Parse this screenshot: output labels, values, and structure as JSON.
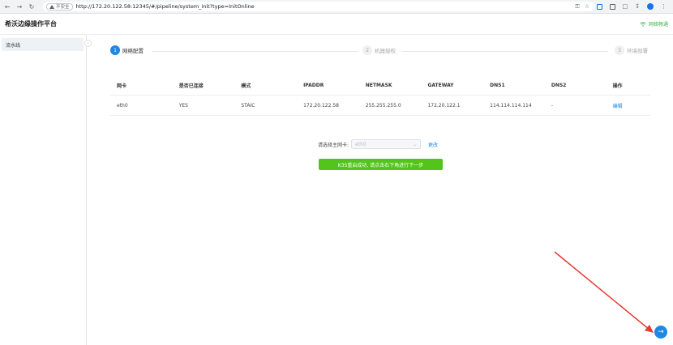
{
  "browser": {
    "insecure_label": "不安全",
    "url": "http://172.20.122.58:12345/#/pipeline/system_init?type=InitOnline"
  },
  "app": {
    "title": "希沃边缘操作平台",
    "network_status": "网络畅通"
  },
  "sidebar": {
    "items": [
      {
        "label": "流水线"
      }
    ]
  },
  "steps": [
    {
      "number": "1",
      "label": "网络配置",
      "state": "active"
    },
    {
      "number": "2",
      "label": "机器授权",
      "state": "inactive"
    },
    {
      "number": "3",
      "label": "环境部署",
      "state": "inactive"
    }
  ],
  "table": {
    "headers": [
      "网卡",
      "是否已连接",
      "模式",
      "IPADDR",
      "NETMASK",
      "GATEWAY",
      "DNS1",
      "DNS2",
      "操作"
    ],
    "rows": [
      [
        "eth0",
        "YES",
        "STAIC",
        "172.20.122.58",
        "255.255.255.0",
        "172.20.122.1",
        "114.114.114.114",
        "-",
        "编辑"
      ]
    ]
  },
  "form": {
    "select_label": "请选择主网卡:",
    "select_value": "eth0",
    "change_label": "更改",
    "status_message": "K3S重启成功, 请点击右下角进行下一步"
  },
  "colors": {
    "primary": "#1e88e5",
    "success": "#52c41a",
    "annotation": "#e53935"
  }
}
